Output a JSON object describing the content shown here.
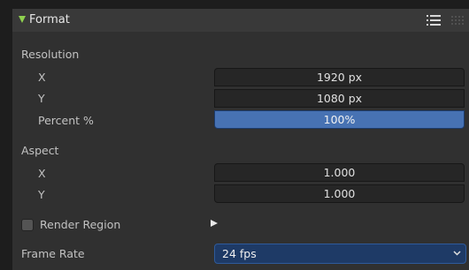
{
  "header": {
    "title": "Format"
  },
  "resolution": {
    "label": "Resolution",
    "x_label": "X",
    "x_value": "1920 px",
    "y_label": "Y",
    "y_value": "1080 px",
    "percent_label": "Percent %",
    "percent_value": "100%"
  },
  "aspect": {
    "label": "Aspect",
    "x_label": "X",
    "x_value": "1.000",
    "y_label": "Y",
    "y_value": "1.000"
  },
  "render_region": {
    "label": "Render Region",
    "checked": false
  },
  "frame_rate": {
    "label": "Frame Rate",
    "value": "24 fps"
  },
  "colors": {
    "panel_bg": "#303030",
    "header_bg": "#393939",
    "accent_green": "#8fd14f",
    "selected_field": "#4772b3",
    "dropdown_bg": "#1e3a66"
  },
  "icons": [
    "expand-triangle-icon",
    "list-icon",
    "drag-grip-icon",
    "play-triangle-icon",
    "chevron-down-icon"
  ]
}
